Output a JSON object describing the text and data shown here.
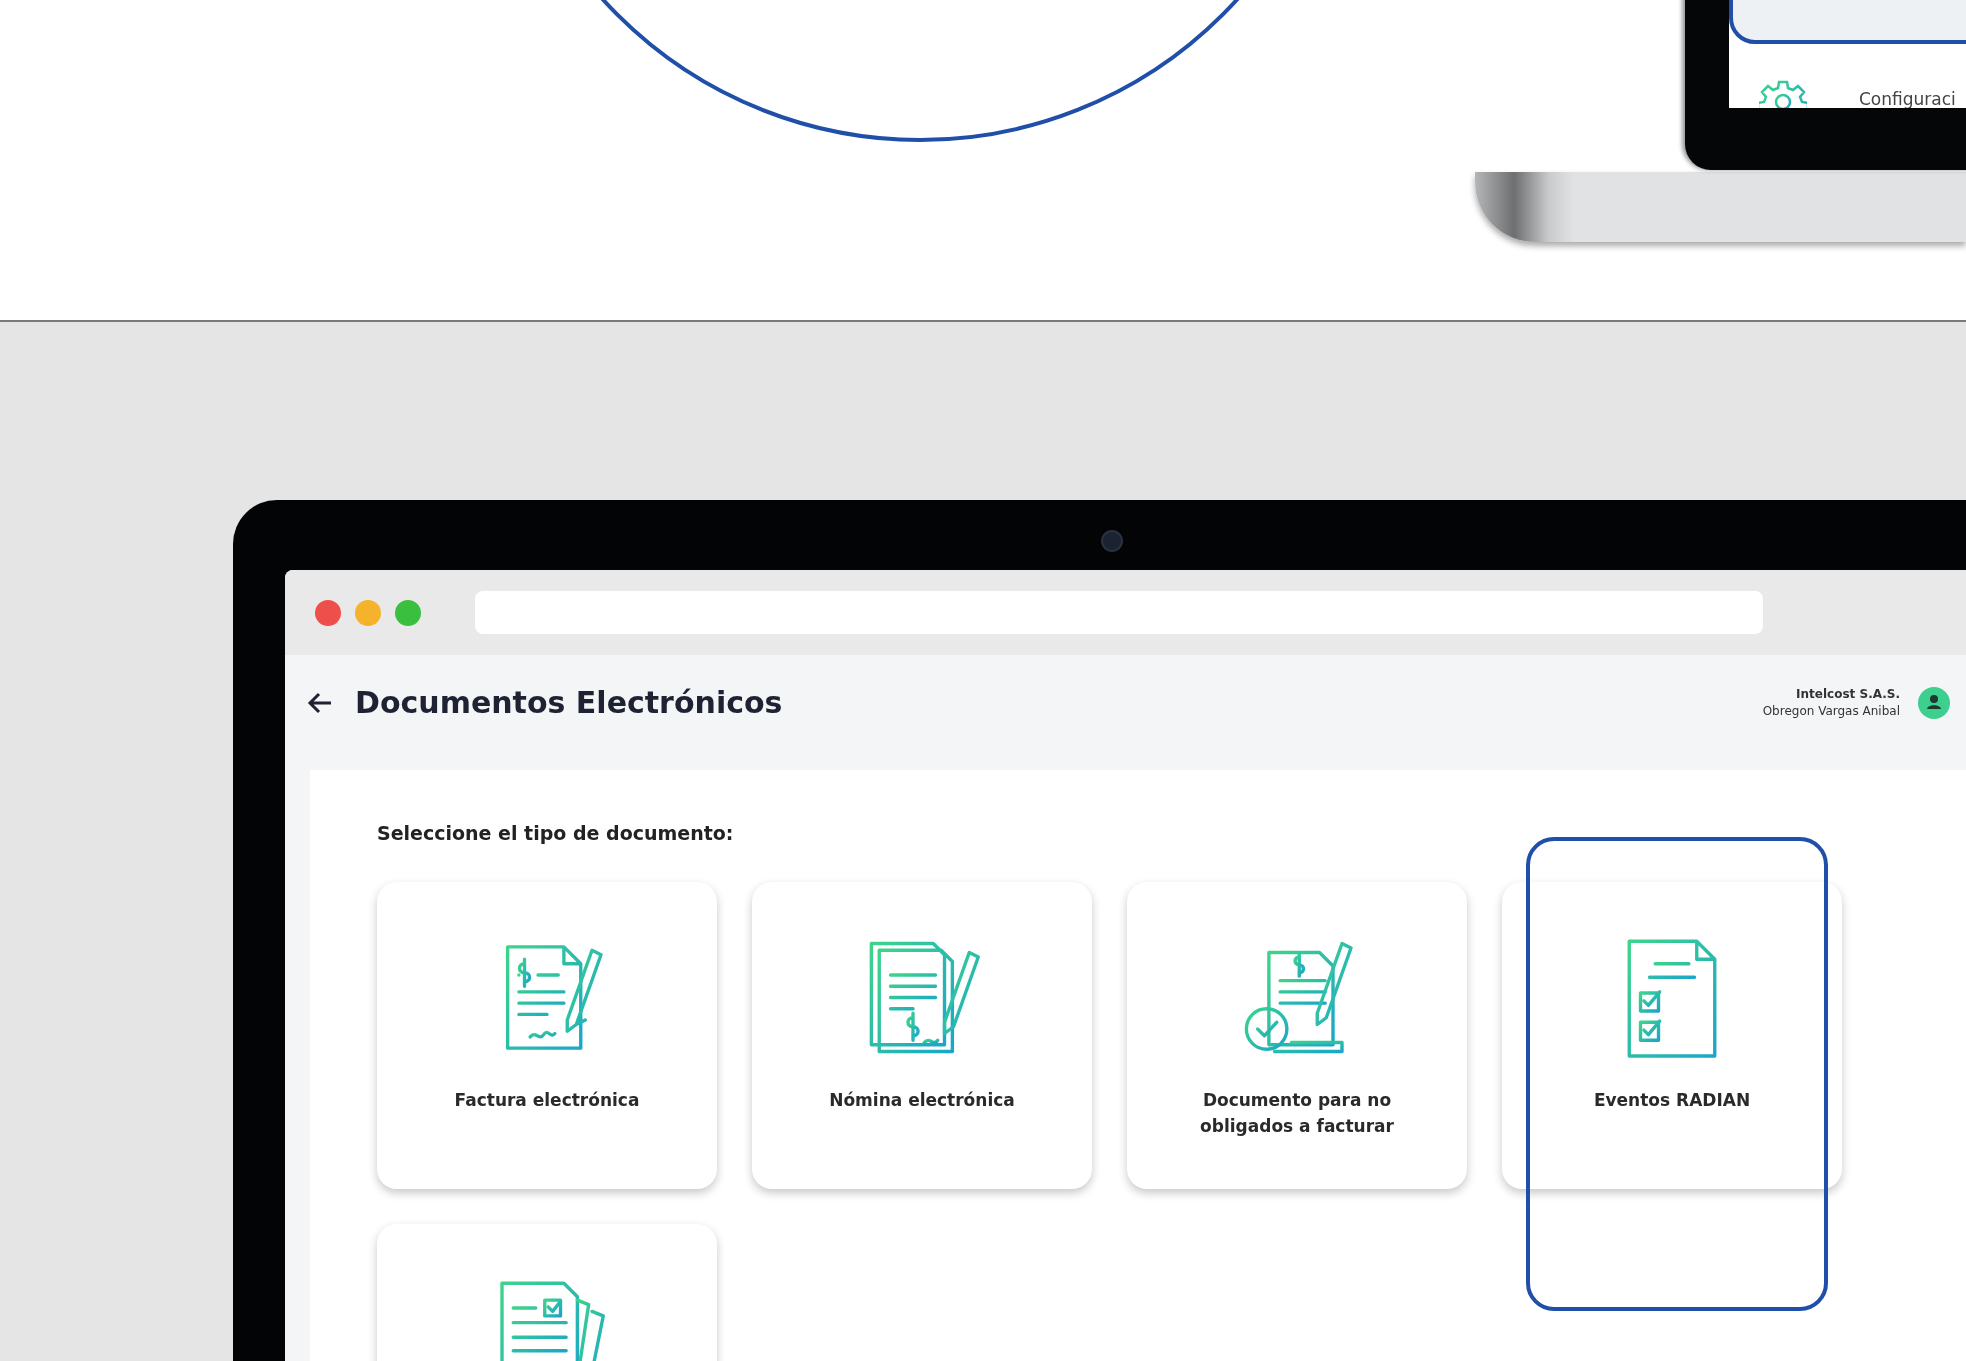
{
  "banner": {
    "laptop_menu_item": "Configuraci"
  },
  "app": {
    "title": "Documentos Electrónicos",
    "company": "Intelcost S.A.S.",
    "user": "Obregon Vargas Anibal",
    "prompt": "Seleccione el tipo de documento:",
    "cards": [
      {
        "label": "Factura electrónica",
        "kind": "invoice",
        "highlighted": false
      },
      {
        "label": "Nómina electrónica",
        "kind": "payroll",
        "highlighted": false
      },
      {
        "label": "Documento para no obligados a facturar",
        "kind": "support",
        "highlighted": false
      },
      {
        "label": "Eventos RADIAN",
        "kind": "checklist",
        "highlighted": true
      },
      {
        "kind": "stack",
        "highlighted": false
      }
    ]
  }
}
